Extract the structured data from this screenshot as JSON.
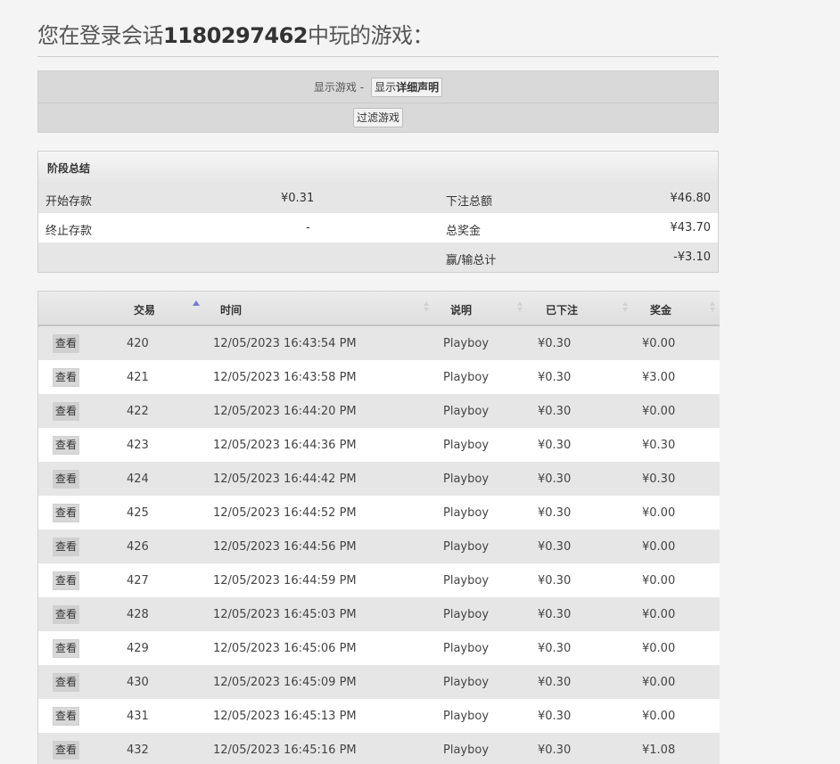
{
  "header": {
    "title_prefix": "您在登录会话",
    "session_id": "1180297462",
    "title_suffix": "中玩的游戏："
  },
  "filters": {
    "show_games_label": "显示游戏 -",
    "show_details_prefix": "显示",
    "show_details_bold": "详细声明",
    "filter_button": "过滤游戏"
  },
  "summary": {
    "heading": "阶段总结",
    "start_balance_label": "开始存款",
    "start_balance_value": "¥0.31",
    "end_balance_label": "终止存款",
    "end_balance_value": "-",
    "total_bet_label": "下注总额",
    "total_bet_value": "¥46.80",
    "total_win_label": "总奖金",
    "total_win_value": "¥43.70",
    "net_label": "赢/输总计",
    "net_value": "-¥3.10"
  },
  "table": {
    "columns": [
      "交易",
      "时间",
      "说明",
      "已下注",
      "奖金"
    ],
    "view_label": "查看",
    "rows": [
      {
        "id": "420",
        "time": "12/05/2023 16:43:54 PM",
        "desc": "Playboy",
        "bet": "¥0.30",
        "win": "¥0.00"
      },
      {
        "id": "421",
        "time": "12/05/2023 16:43:58 PM",
        "desc": "Playboy",
        "bet": "¥0.30",
        "win": "¥3.00"
      },
      {
        "id": "422",
        "time": "12/05/2023 16:44:20 PM",
        "desc": "Playboy",
        "bet": "¥0.30",
        "win": "¥0.00"
      },
      {
        "id": "423",
        "time": "12/05/2023 16:44:36 PM",
        "desc": "Playboy",
        "bet": "¥0.30",
        "win": "¥0.30"
      },
      {
        "id": "424",
        "time": "12/05/2023 16:44:42 PM",
        "desc": "Playboy",
        "bet": "¥0.30",
        "win": "¥0.30"
      },
      {
        "id": "425",
        "time": "12/05/2023 16:44:52 PM",
        "desc": "Playboy",
        "bet": "¥0.30",
        "win": "¥0.00"
      },
      {
        "id": "426",
        "time": "12/05/2023 16:44:56 PM",
        "desc": "Playboy",
        "bet": "¥0.30",
        "win": "¥0.00"
      },
      {
        "id": "427",
        "time": "12/05/2023 16:44:59 PM",
        "desc": "Playboy",
        "bet": "¥0.30",
        "win": "¥0.00"
      },
      {
        "id": "428",
        "time": "12/05/2023 16:45:03 PM",
        "desc": "Playboy",
        "bet": "¥0.30",
        "win": "¥0.00"
      },
      {
        "id": "429",
        "time": "12/05/2023 16:45:06 PM",
        "desc": "Playboy",
        "bet": "¥0.30",
        "win": "¥0.00"
      },
      {
        "id": "430",
        "time": "12/05/2023 16:45:09 PM",
        "desc": "Playboy",
        "bet": "¥0.30",
        "win": "¥0.00"
      },
      {
        "id": "431",
        "time": "12/05/2023 16:45:13 PM",
        "desc": "Playboy",
        "bet": "¥0.30",
        "win": "¥0.00"
      },
      {
        "id": "432",
        "time": "12/05/2023 16:45:16 PM",
        "desc": "Playboy",
        "bet": "¥0.30",
        "win": "¥1.08"
      }
    ]
  }
}
